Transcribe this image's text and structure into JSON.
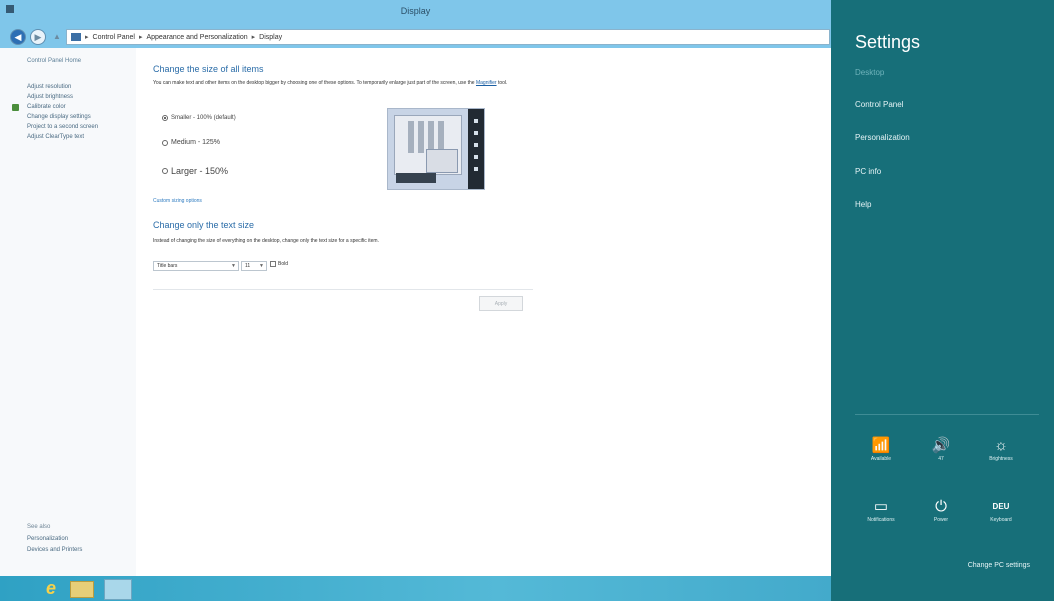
{
  "window": {
    "title": "Display"
  },
  "address": {
    "crumbs": [
      "Control Panel",
      "Appearance and Personalization",
      "Display"
    ],
    "separator": "▸"
  },
  "leftnav": {
    "home": "Control Panel Home",
    "items": [
      "Adjust resolution",
      "Adjust brightness",
      "Calibrate color",
      "Change display settings",
      "Project to a second screen",
      "Adjust ClearType text"
    ],
    "see_also_title": "See also",
    "see_also": [
      "Personalization",
      "Devices and Printers"
    ]
  },
  "main": {
    "heading": "Change the size of all items",
    "description": "You can make text and other items on the desktop bigger by choosing one of these options. To temporarily enlarge just part of the screen, use the",
    "magnifier_link": "Magnifier",
    "description_end": "tool.",
    "options": [
      {
        "label": "Smaller - 100% (default)",
        "selected": true
      },
      {
        "label": "Medium - 125%",
        "selected": false
      },
      {
        "label": "Larger - 150%",
        "selected": false
      }
    ],
    "custom_link": "Custom sizing options",
    "text_heading": "Change only the text size",
    "text_description": "Instead of changing the size of everything on the desktop, change only the text size for a specific item.",
    "item_select": "Title bars",
    "size_select": "11",
    "bold_label": "Bold",
    "apply": "Apply"
  },
  "charms": {
    "title": "Settings",
    "links": [
      "Desktop",
      "Control Panel",
      "Personalization",
      "PC info",
      "Help"
    ],
    "tiles": [
      {
        "label": "Available",
        "icon": "network-icon",
        "glyph": "📶"
      },
      {
        "label": "47",
        "icon": "volume-icon",
        "glyph": "🔊"
      },
      {
        "label": "Brightness",
        "icon": "brightness-icon",
        "glyph": "☼"
      },
      {
        "label": "Notifications",
        "icon": "notifications-icon",
        "glyph": "▭"
      },
      {
        "label": "Power",
        "icon": "power-icon",
        "glyph": "⏻"
      },
      {
        "label": "Keyboard",
        "icon": "keyboard-icon",
        "glyph": "DEU"
      }
    ],
    "change_pc": "Change PC settings"
  },
  "taskbar": {
    "ie_glyph": "e"
  },
  "colors": {
    "charms_bg": "#176f79",
    "titlebar": "#7fc6ea",
    "link": "#2a6ca8"
  }
}
